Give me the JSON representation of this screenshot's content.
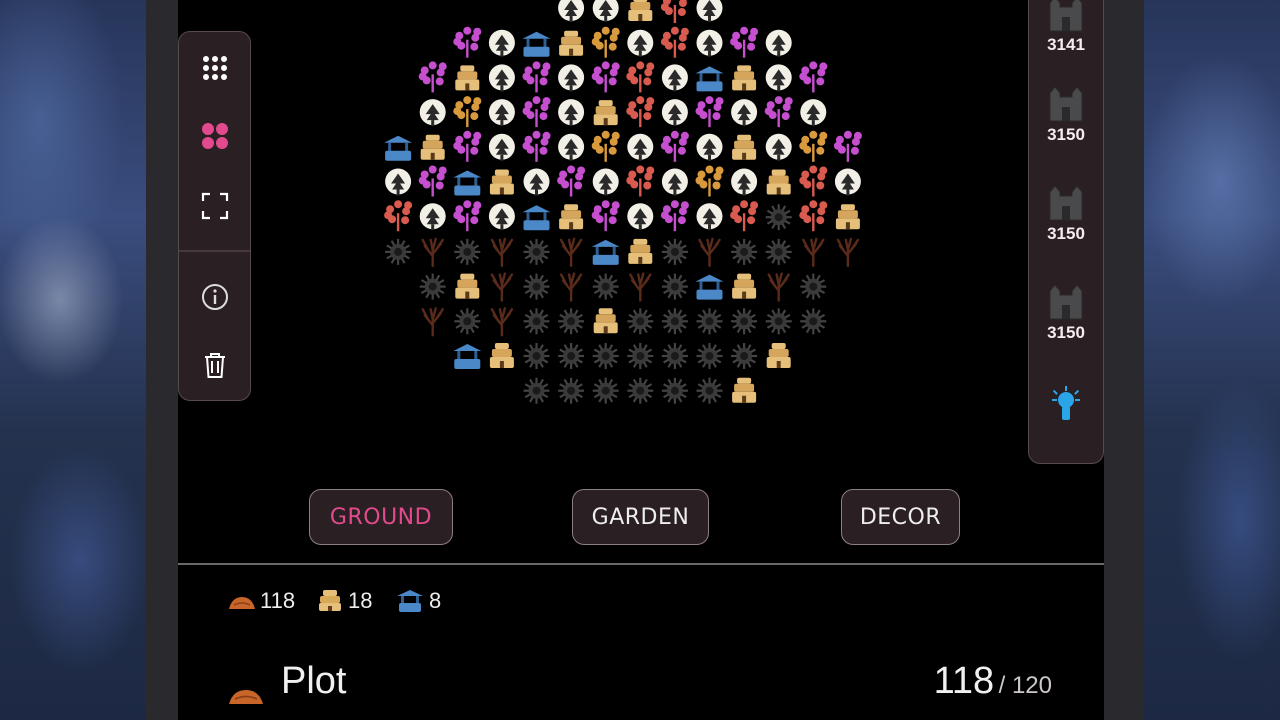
{
  "tools": [
    {
      "name": "grid-dots-icon",
      "active": false
    },
    {
      "name": "four-dots-icon",
      "active": true
    },
    {
      "name": "fullscreen-icon",
      "active": false
    },
    {
      "name": "info-icon",
      "active": false
    },
    {
      "name": "trash-icon",
      "active": false
    }
  ],
  "castles": [
    {
      "value": "3141"
    },
    {
      "value": "3150"
    },
    {
      "value": "3150"
    },
    {
      "value": "3150"
    }
  ],
  "beacon_icon": "lighthouse-icon",
  "tabs": [
    {
      "label": "GROUND",
      "active": true
    },
    {
      "label": "GARDEN",
      "active": false
    },
    {
      "label": "DECOR",
      "active": false
    }
  ],
  "resource_counts": [
    {
      "icon": "plot-icon",
      "value": "118"
    },
    {
      "icon": "beehive-icon",
      "value": "18"
    },
    {
      "icon": "well-icon",
      "value": "8"
    }
  ],
  "plot": {
    "title": "Plot",
    "current": "118",
    "max": "/ 120"
  },
  "colors": {
    "accent": "#e24a8d",
    "panel": "#2a1f22",
    "pine": "#f2efe6",
    "flower_pink": "#c64fd0",
    "flower_red": "#d95a4e",
    "flower_gold": "#d99a3e",
    "beehive": "#e6c07a",
    "well": "#4a88c7",
    "withered": "#5a2a1a",
    "gear": "#3a3a3a",
    "beacon": "#2aa6e8"
  },
  "board": {
    "tiles": [
      "....PPHRP...",
      ".FPWHGPRPFP.",
      ".FHPFPFRPWHPF.",
      ".PGPFPHRPFPFP.",
      "WHFPFPGPFPHPGF",
      "PFWHPFPRPGPHRP",
      "RPFPWHFPFPRSRH",
      "SDSDSDWHSDSSDD",
      ".SHDSDSDSWHDS.",
      ".DSDSSHSSSSSS.",
      "..WHSSSSSSSH..",
      "....SSSSSSH..."
    ]
  }
}
